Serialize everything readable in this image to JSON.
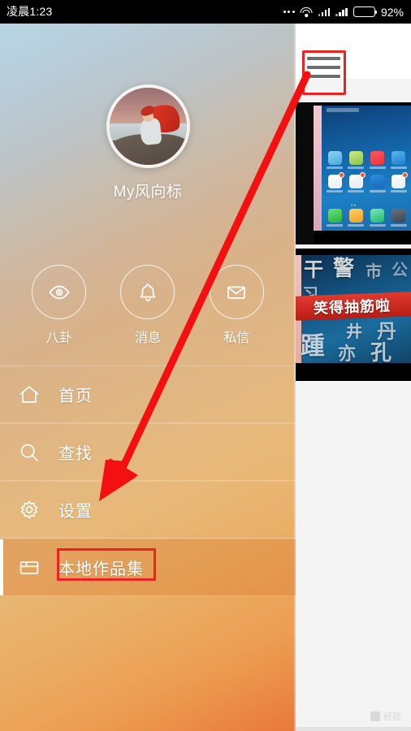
{
  "status_bar": {
    "time": "凌晨1:23",
    "battery_percent": "92%",
    "battery_level": 92,
    "icons": [
      "more-dots-icon",
      "wifi-icon",
      "signal-icon",
      "signal-icon",
      "battery-icon"
    ]
  },
  "app_bar": {
    "menu_icon": "hamburger-menu-icon",
    "highlighted": true,
    "highlight_color": "#ee2222"
  },
  "drawer": {
    "profile": {
      "avatar_alt": "用户头像",
      "username": "My风向标"
    },
    "actions": [
      {
        "label": "八卦",
        "icon": "eye-icon"
      },
      {
        "label": "消息",
        "icon": "bell-icon"
      },
      {
        "label": "私信",
        "icon": "envelope-icon"
      }
    ],
    "menu_items": [
      {
        "label": "首页",
        "icon": "home-icon",
        "selected": false
      },
      {
        "label": "查找",
        "icon": "search-icon",
        "selected": false
      },
      {
        "label": "设置",
        "icon": "gear-icon",
        "selected": false
      },
      {
        "label": "本地作品集",
        "icon": "folder-icon",
        "selected": true,
        "highlighted": true
      }
    ]
  },
  "thumbnails": [
    {
      "name": "phone-home-screen-screenshot",
      "caption": ""
    },
    {
      "name": "video-poster-thumbnail",
      "caption": "笑得抽筋啦"
    }
  ],
  "annotation": {
    "arrow_color": "#f41010",
    "highlight_box_color": "#ee2222",
    "description": "红色箭头由菜单按钮指向本地作品集"
  },
  "watermark": {
    "text": "经验"
  }
}
